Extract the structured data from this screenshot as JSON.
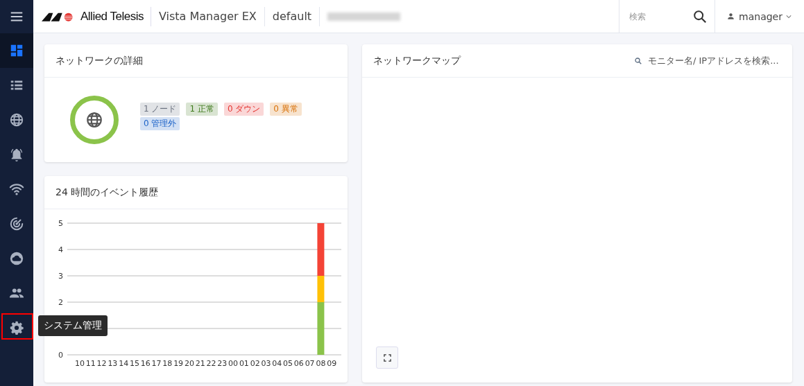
{
  "header": {
    "brand": "Allied Telesis",
    "product": "Vista Manager EX",
    "site": "default",
    "search": {
      "placeholder": "検索"
    },
    "user": "manager"
  },
  "sidebar": {
    "items": [
      {
        "kind": "dashboard",
        "selected": true,
        "highlighted": false
      },
      {
        "kind": "list",
        "selected": false,
        "highlighted": false
      },
      {
        "kind": "globe",
        "selected": false,
        "highlighted": false
      },
      {
        "kind": "bell",
        "selected": false,
        "highlighted": false
      },
      {
        "kind": "wifi",
        "selected": false,
        "highlighted": false
      },
      {
        "kind": "radar",
        "selected": false,
        "highlighted": false
      },
      {
        "kind": "cloud",
        "selected": false,
        "highlighted": false
      },
      {
        "kind": "people",
        "selected": false,
        "highlighted": false
      },
      {
        "kind": "gear",
        "selected": false,
        "highlighted": true,
        "tooltip": "システム管理"
      }
    ]
  },
  "network_details": {
    "title": "ネットワークの詳細",
    "badges": [
      {
        "text": "1 ノード",
        "color": "#6b7280"
      },
      {
        "text": "1 正常",
        "color": "#3f7a1c"
      },
      {
        "text": "0 ダウン",
        "color": "#e53935"
      },
      {
        "text": "0 異常",
        "color": "#d9720b"
      },
      {
        "text": "0 管理外",
        "color": "#1e64c8"
      }
    ]
  },
  "event_history": {
    "title": "24 時間のイベント履歴",
    "chart_data": {
      "type": "bar",
      "stacked": true,
      "grid": true,
      "categories": [
        "10",
        "11",
        "12",
        "13",
        "14",
        "15",
        "16",
        "17",
        "18",
        "19",
        "20",
        "21",
        "22",
        "23",
        "00",
        "01",
        "02",
        "03",
        "04",
        "05",
        "06",
        "07",
        "08",
        "09"
      ],
      "ylim": [
        0,
        5
      ],
      "yticks": [
        0,
        2,
        3,
        4,
        5
      ],
      "series": [
        {
          "color": "#8bc34a",
          "values": [
            0,
            0,
            0,
            0,
            0,
            0,
            0,
            0,
            0,
            0,
            0,
            0,
            0,
            0,
            0,
            0,
            0,
            0,
            0,
            0,
            0,
            0,
            2,
            0
          ]
        },
        {
          "color": "#ffc107",
          "values": [
            0,
            0,
            0,
            0,
            0,
            0,
            0,
            0,
            0,
            0,
            0,
            0,
            0,
            0,
            0,
            0,
            0,
            0,
            0,
            0,
            0,
            0,
            1,
            0
          ]
        },
        {
          "color": "#f44336",
          "values": [
            0,
            0,
            0,
            0,
            0,
            0,
            0,
            0,
            0,
            0,
            0,
            0,
            0,
            0,
            0,
            0,
            0,
            0,
            0,
            0,
            0,
            0,
            2,
            0
          ]
        }
      ]
    }
  },
  "network_map": {
    "title": "ネットワークマップ",
    "search": {
      "placeholder": "モニター名/ IPアドレスを検索..."
    }
  }
}
